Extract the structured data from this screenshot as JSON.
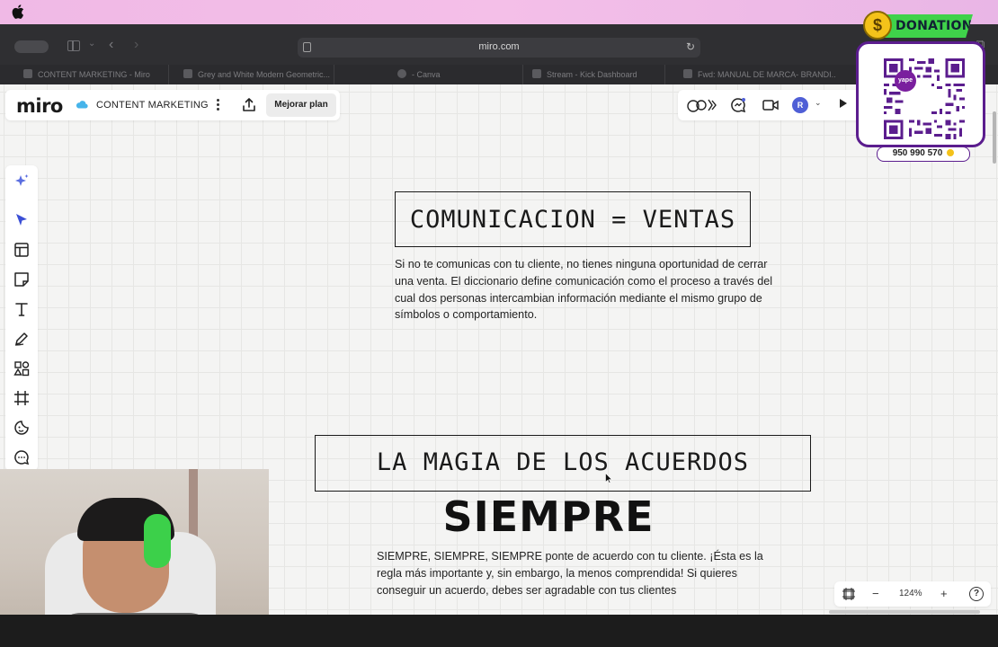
{
  "browser": {
    "url": "miro.com",
    "tabs": [
      {
        "label": "CONTENT MARKETING - Miro"
      },
      {
        "label": "Grey and White Modern Geometric..."
      },
      {
        "label": "- Canva"
      },
      {
        "label": "Stream - Kick Dashboard"
      },
      {
        "label": "Fwd: MANUAL DE MARCA- BRANDI..."
      }
    ]
  },
  "miro": {
    "logo": "miro",
    "board_name": "CONTENT MARKETING",
    "upgrade_label": "Mejorar plan",
    "avatar_initial": "R",
    "zoom": "124%"
  },
  "board": {
    "title1": "COMUNICACION = VENTAS",
    "paragraph1": "Si no te comunicas con tu cliente, no tienes ninguna oportunidad de cerrar una venta. El diccionario define comunicación como el proceso a través del cual dos personas intercambian información mediante el mismo grupo de símbolos o comportamiento.",
    "title2": "LA MAGIA DE LOS ACUERDOS",
    "big_word": "SIEMPRE",
    "paragraph2": "SIEMPRE, SIEMPRE, SIEMPRE ponte de acuerdo con tu cliente. ¡Ésta es la regla más importante y, sin embargo, la menos comprendida! Si quieres conseguir un acuerdo, debes ser agradable con tus clientes"
  },
  "overlay": {
    "donations_label": "DONATIONS",
    "coin_symbol": "$",
    "yape_label": "yape",
    "phone": "950 990 570"
  },
  "colors": {
    "accent_blue": "#4f5fd6",
    "donations_green": "#3fd24a",
    "yape_purple": "#5b1d8e"
  }
}
